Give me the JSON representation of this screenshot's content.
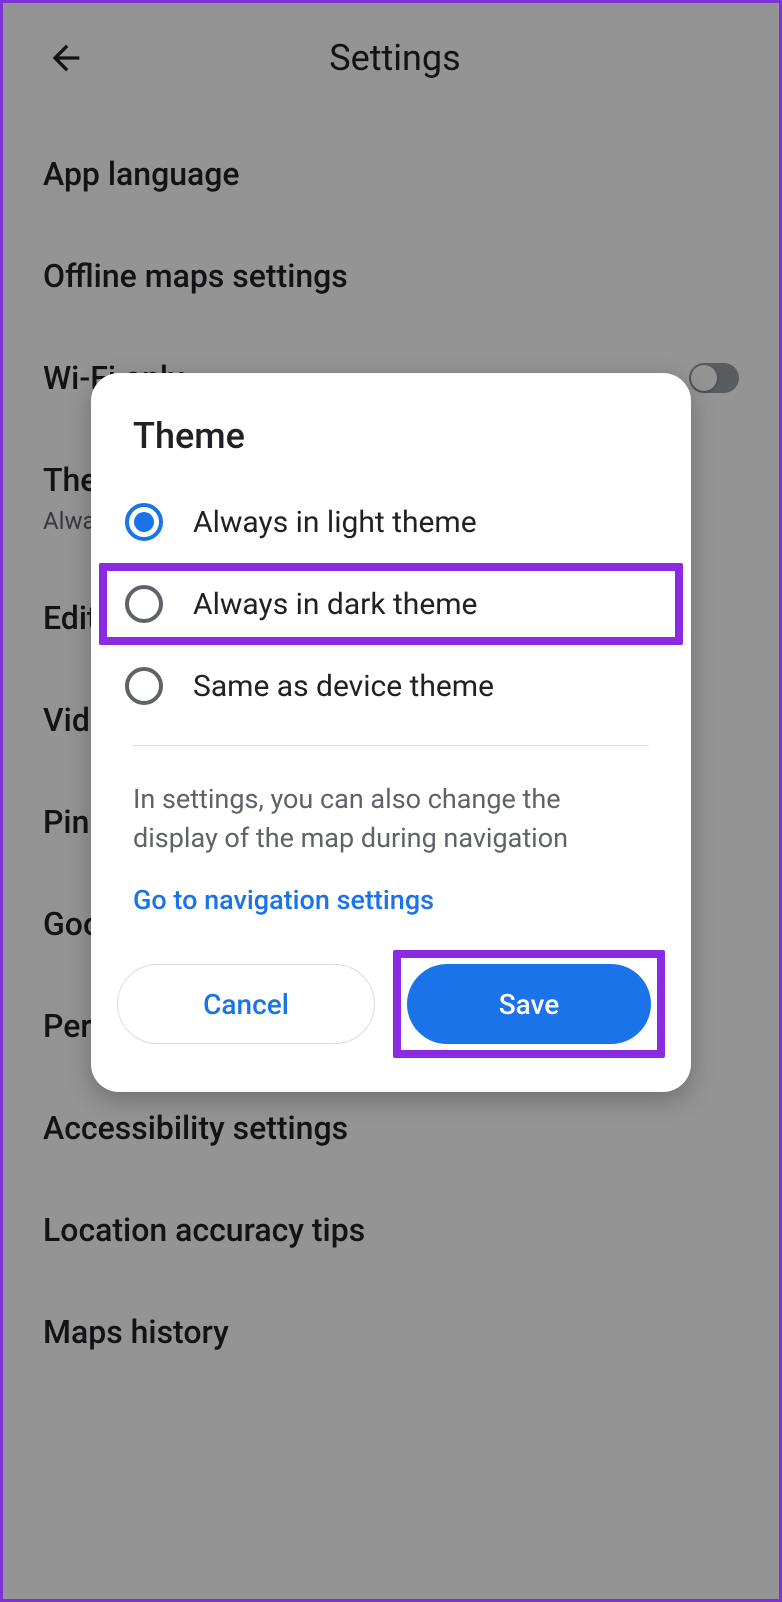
{
  "header": {
    "title": "Settings"
  },
  "settings": {
    "app_language": "App language",
    "offline_maps": "Offline maps settings",
    "wifi_only": "Wi-Fi only",
    "theme": "Theme",
    "theme_sub": "Always in light theme",
    "edit_home_work": "Edit home or work",
    "video": "Video settings",
    "pinned_trips": "Pinned trips",
    "google_location": "Google location settings",
    "personal_content": "Personal content",
    "accessibility": "Accessibility settings",
    "location_tips": "Location accuracy tips",
    "maps_history": "Maps history"
  },
  "dialog": {
    "title": "Theme",
    "options": [
      {
        "label": "Always in light theme",
        "selected": true,
        "highlighted": false
      },
      {
        "label": "Always in dark theme",
        "selected": false,
        "highlighted": true
      },
      {
        "label": "Same as device theme",
        "selected": false,
        "highlighted": false
      }
    ],
    "hint": "In settings, you can also change the display of the map during navigation",
    "link": "Go to navigation settings",
    "cancel": "Cancel",
    "save": "Save"
  }
}
